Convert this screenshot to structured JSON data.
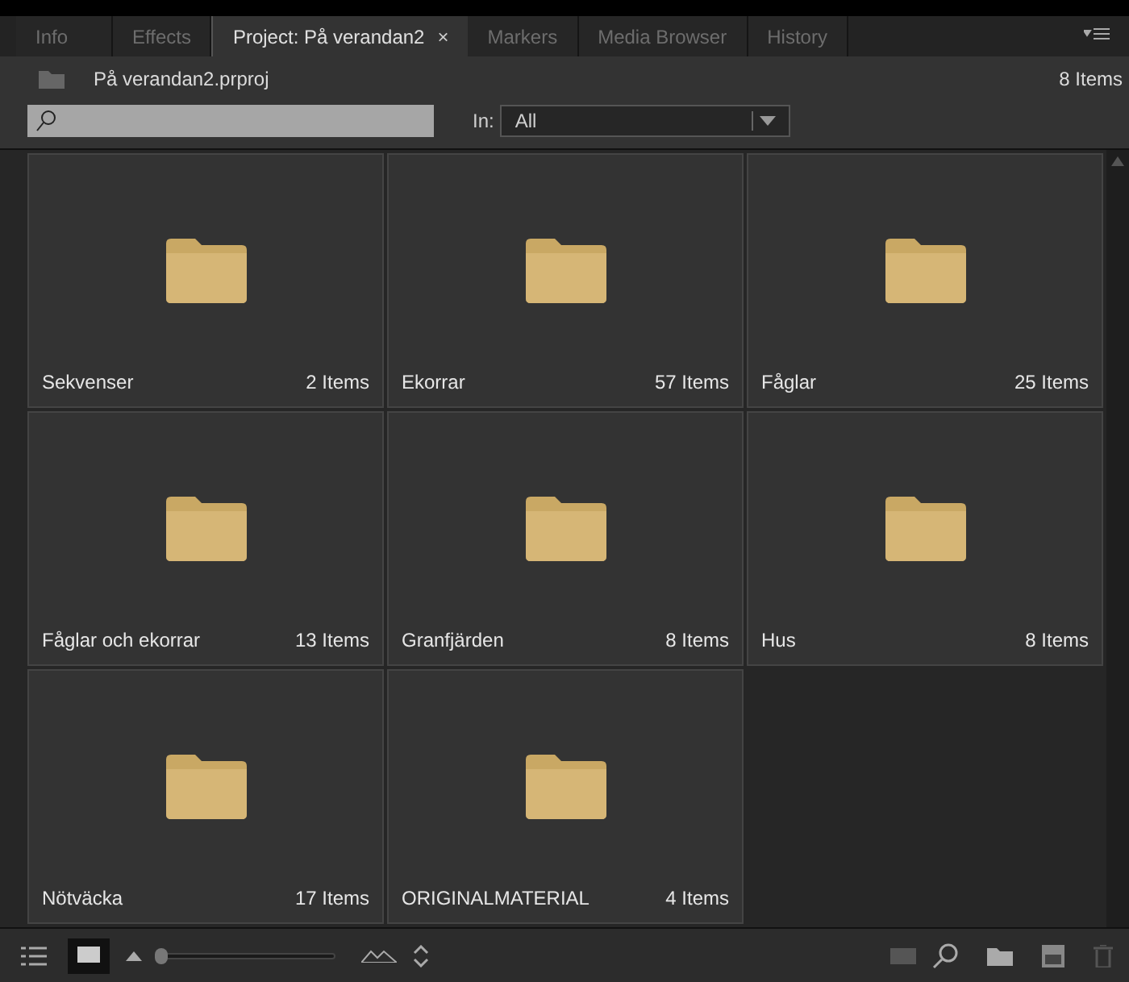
{
  "tabs": [
    {
      "label": "Info",
      "selected": false,
      "closable": false
    },
    {
      "label": "Effects",
      "selected": false,
      "closable": false
    },
    {
      "label": "Project: På verandan2",
      "selected": true,
      "closable": true
    },
    {
      "label": "Markers",
      "selected": false,
      "closable": false
    },
    {
      "label": "Media Browser",
      "selected": false,
      "closable": false
    },
    {
      "label": "History",
      "selected": false,
      "closable": false
    }
  ],
  "close_glyph": "×",
  "project": {
    "name": "På verandan2.prproj",
    "count": "8 Items"
  },
  "filter": {
    "label": "In:",
    "value": "All"
  },
  "bins": [
    {
      "name": "Sekvenser",
      "count": "2 Items"
    },
    {
      "name": "Ekorrar",
      "count": "57 Items"
    },
    {
      "name": "Fåglar",
      "count": "25 Items"
    },
    {
      "name": "Fåglar och ekorrar",
      "count": "13 Items"
    },
    {
      "name": "Granfjärden",
      "count": "8 Items"
    },
    {
      "name": "Hus",
      "count": "8 Items"
    },
    {
      "name": "Nötväcka",
      "count": "17 Items"
    },
    {
      "name": "ORIGINALMATERIAL",
      "count": "4 Items"
    }
  ],
  "view": {
    "list_selected": false,
    "icon_selected": true,
    "zoom": {
      "level": 0.02
    }
  }
}
